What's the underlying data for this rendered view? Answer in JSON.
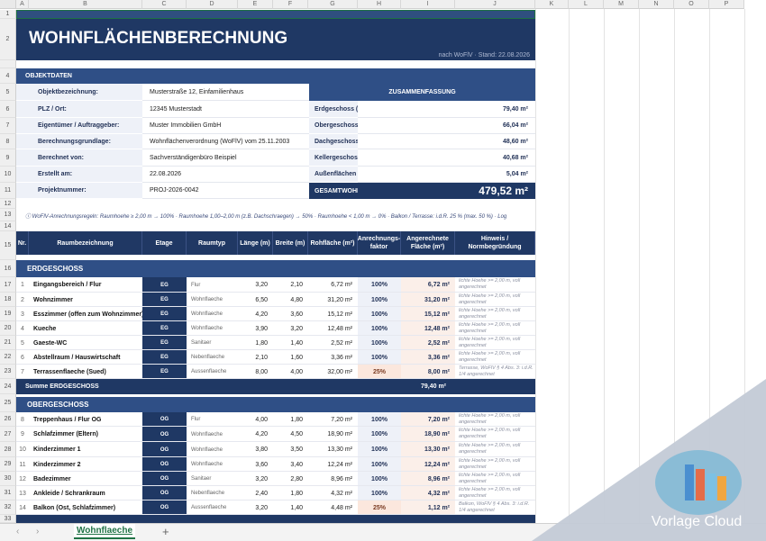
{
  "columns": [
    "A",
    "B",
    "C",
    "D",
    "E",
    "F",
    "G",
    "H",
    "I",
    "J",
    "K",
    "L",
    "M",
    "N",
    "O",
    "P"
  ],
  "rows_header": [
    "1",
    "2",
    "",
    "4",
    "5",
    "6",
    "7",
    "8",
    "9",
    "10",
    "11",
    "12",
    "13",
    "14",
    "15",
    "16",
    "17",
    "18",
    "19",
    "20",
    "21",
    "22",
    "23",
    "24",
    "25",
    "26",
    "27",
    "28",
    "29",
    "30",
    "31",
    "32",
    "33"
  ],
  "title": "WOHNFLÄCHENBERECHNUNG",
  "subtitle": "nach WoFlV · Stand: 22.08.2026",
  "objektdaten_header": "OBJEKTDATEN",
  "objekt": [
    {
      "label": "Objektbezeichnung:",
      "value": "Musterstraße 12, Einfamilienhaus"
    },
    {
      "label": "PLZ / Ort:",
      "value": "12345 Musterstadt"
    },
    {
      "label": "Eigentümer / Auftraggeber:",
      "value": "Muster Immobilien GmbH"
    },
    {
      "label": "Berechnungsgrundlage:",
      "value": "Wohnflächenverordnung (WoFlV) vom 25.11.2003"
    },
    {
      "label": "Berechnet von:",
      "value": "Sachverständigenbüro Beispiel"
    },
    {
      "label": "Erstellt am:",
      "value": "22.08.2026"
    },
    {
      "label": "Projektnummer:",
      "value": "PROJ-2026-0042"
    }
  ],
  "summary": {
    "header": "ZUSAMMENFASSUNG",
    "items": [
      {
        "label": "Erdgeschoss (E",
        "value": "79,40 m²"
      },
      {
        "label": "Obergeschoss",
        "value": "66,04 m²"
      },
      {
        "label": "Dachgeschoss",
        "value": "48,60 m²"
      },
      {
        "label": "Kellergeschos",
        "value": "40,68 m²"
      },
      {
        "label": "Außenflächen",
        "value": "5,04 m²"
      }
    ],
    "total_label": "GESAMTWOHI",
    "total_value": "479,52 m²"
  },
  "rules": "ⓘ WoFlV-Anrechnungsregeln:  Raumhoehe ≥ 2,00 m → 100%   ·   Raumhoehe 1,00–2,00 m (z.B. Dachschraegen) → 50%   ·   Raumhoehe < 1,00 m → 0%   ·   Balkon / Terrasse: i.d.R. 25 % (max. 50 %)   ·   Log",
  "table_headers": {
    "nr": "Nr.",
    "name": "Raumbezeichnung",
    "etage": "Etage",
    "typ": "Raumtyp",
    "laenge": "Länge (m)",
    "breite": "Breite (m)",
    "roh": "Rohfläche (m²)",
    "faktor": "Anrechnungs-faktor",
    "ang": "Angerechnete Fläche (m²)",
    "hinweis": "Hinweis / Normbegründung"
  },
  "sections": [
    {
      "title": "ERDGESCHOSS",
      "rows": [
        {
          "nr": "1",
          "name": "Eingangsbereich / Flur",
          "etage": "EG",
          "typ": "Flur",
          "l": "3,20",
          "b": "2,10",
          "roh": "6,72 m²",
          "f": "100%",
          "ang": "6,72 m²",
          "hint": "lichte Hoehe >= 2,00 m, voll angerechnet"
        },
        {
          "nr": "2",
          "name": "Wohnzimmer",
          "etage": "EG",
          "typ": "Wohnflaeche",
          "l": "6,50",
          "b": "4,80",
          "roh": "31,20 m²",
          "f": "100%",
          "ang": "31,20 m²",
          "hint": "lichte Hoehe >= 2,00 m, voll angerechnet"
        },
        {
          "nr": "3",
          "name": "Esszimmer (offen zum Wohnzimmer)",
          "etage": "EG",
          "typ": "Wohnflaeche",
          "l": "4,20",
          "b": "3,60",
          "roh": "15,12 m²",
          "f": "100%",
          "ang": "15,12 m²",
          "hint": "lichte Hoehe >= 2,00 m, voll angerechnet"
        },
        {
          "nr": "4",
          "name": "Kueche",
          "etage": "EG",
          "typ": "Wohnflaeche",
          "l": "3,90",
          "b": "3,20",
          "roh": "12,48 m²",
          "f": "100%",
          "ang": "12,48 m²",
          "hint": "lichte Hoehe >= 2,00 m, voll angerechnet"
        },
        {
          "nr": "5",
          "name": "Gaeste-WC",
          "etage": "EG",
          "typ": "Sanitaer",
          "l": "1,80",
          "b": "1,40",
          "roh": "2,52 m²",
          "f": "100%",
          "ang": "2,52 m²",
          "hint": "lichte Hoehe >= 2,00 m, voll angerechnet"
        },
        {
          "nr": "6",
          "name": "Abstellraum / Hauswirtschaft",
          "etage": "EG",
          "typ": "Nebenflaeche",
          "l": "2,10",
          "b": "1,60",
          "roh": "3,36 m²",
          "f": "100%",
          "ang": "3,36 m²",
          "hint": "lichte Hoehe >= 2,00 m, voll angerechnet"
        },
        {
          "nr": "7",
          "name": "Terrassenflaeche (Sued)",
          "etage": "EG",
          "typ": "Aussenflaeche",
          "l": "8,00",
          "b": "4,00",
          "roh": "32,00 m²",
          "f": "25%",
          "ang": "8,00 m²",
          "hint": "Terrasse, WoFlV § 4 Abs. 3: i.d.R. 1/4 angerechnet"
        }
      ],
      "sum_label": "Summe ERDGESCHOSS",
      "sum_value": "79,40 m²"
    },
    {
      "title": "OBERGESCHOSS",
      "rows": [
        {
          "nr": "8",
          "name": "Treppenhaus / Flur OG",
          "etage": "OG",
          "typ": "Flur",
          "l": "4,00",
          "b": "1,80",
          "roh": "7,20 m²",
          "f": "100%",
          "ang": "7,20 m²",
          "hint": "lichte Hoehe >= 2,00 m, voll angerechnet"
        },
        {
          "nr": "9",
          "name": "Schlafzimmer (Eltern)",
          "etage": "OG",
          "typ": "Wohnflaeche",
          "l": "4,20",
          "b": "4,50",
          "roh": "18,90 m²",
          "f": "100%",
          "ang": "18,90 m²",
          "hint": "lichte Hoehe >= 2,00 m, voll angerechnet"
        },
        {
          "nr": "10",
          "name": "Kinderzimmer 1",
          "etage": "OG",
          "typ": "Wohnflaeche",
          "l": "3,80",
          "b": "3,50",
          "roh": "13,30 m²",
          "f": "100%",
          "ang": "13,30 m²",
          "hint": "lichte Hoehe >= 2,00 m, voll angerechnet"
        },
        {
          "nr": "11",
          "name": "Kinderzimmer 2",
          "etage": "OG",
          "typ": "Wohnflaeche",
          "l": "3,60",
          "b": "3,40",
          "roh": "12,24 m²",
          "f": "100%",
          "ang": "12,24 m²",
          "hint": "lichte Hoehe >= 2,00 m, voll angerechnet"
        },
        {
          "nr": "12",
          "name": "Badezimmer",
          "etage": "OG",
          "typ": "Sanitaer",
          "l": "3,20",
          "b": "2,80",
          "roh": "8,96 m²",
          "f": "100%",
          "ang": "8,96 m²",
          "hint": "lichte Hoehe >= 2,00 m, voll angerechnet"
        },
        {
          "nr": "13",
          "name": "Ankleide / Schrankraum",
          "etage": "OG",
          "typ": "Nebenflaeche",
          "l": "2,40",
          "b": "1,80",
          "roh": "4,32 m²",
          "f": "100%",
          "ang": "4,32 m²",
          "hint": "lichte Hoehe >= 2,00 m, voll angerechnet"
        },
        {
          "nr": "14",
          "name": "Balkon (Ost, Schlafzimmer)",
          "etage": "OG",
          "typ": "Aussenflaeche",
          "l": "3,20",
          "b": "1,40",
          "roh": "4,48 m²",
          "f": "25%",
          "ang": "1,12 m²",
          "hint": "Balkon, WoFlV § 4 Abs. 3: i.d.R. 1/4 angerechnet"
        }
      ]
    }
  ],
  "sheet_tab": "Wohnflaeche",
  "watermark": "Vorlage Cloud",
  "colors": {
    "navy": "#1f3864",
    "accent": "#217346",
    "faktor_bg": "#eef1f8",
    "ang_bg": "#fbefe9"
  }
}
